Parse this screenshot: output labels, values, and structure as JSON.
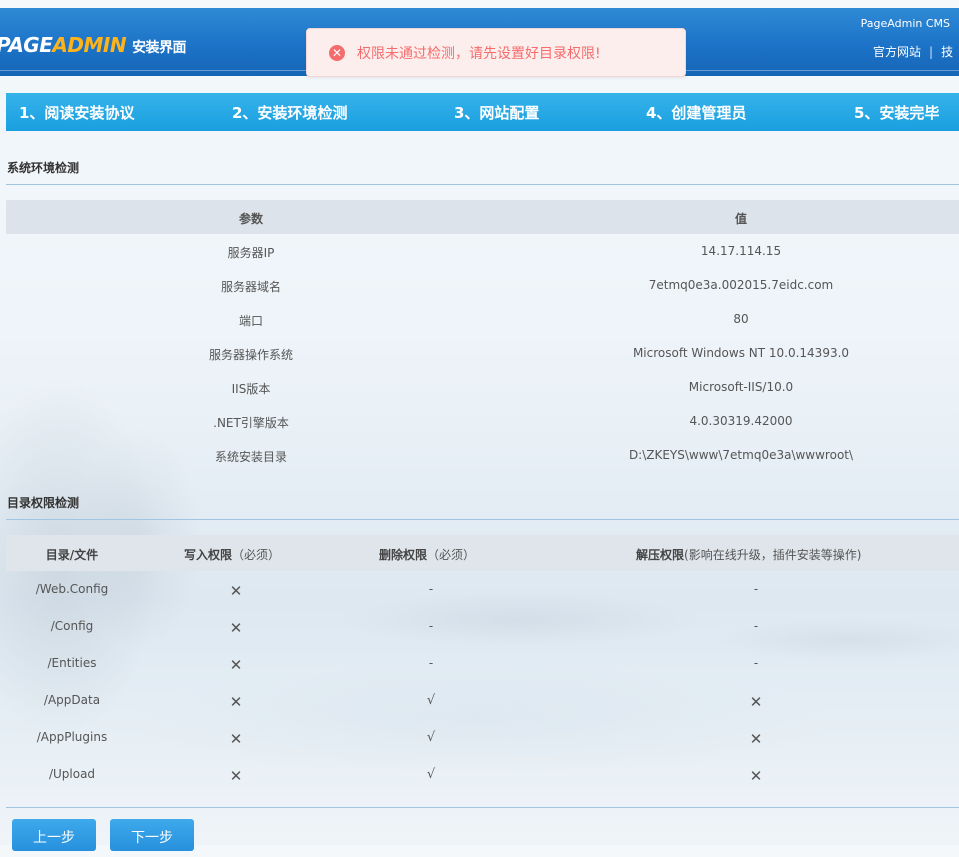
{
  "header": {
    "logo_part1": "PAGE",
    "logo_part2": "ADMIN",
    "logo_part3": "安装界面",
    "cms_label": "PageAdmin CMS",
    "links": [
      "官方网站",
      "技"
    ]
  },
  "toast": {
    "icon": "error-circle-icon",
    "message": "权限未通过检测，请先设置好目录权限!",
    "color": "#f56c6c"
  },
  "steps": [
    "1、阅读安装协议",
    "2、安装环境检测",
    "3、网站配置",
    "4、创建管理员",
    "5、安装完毕"
  ],
  "env_section": {
    "title": "系统环境检测",
    "headers": [
      "参数",
      "值"
    ],
    "rows": [
      {
        "param": "服务器IP",
        "value": "14.17.114.15"
      },
      {
        "param": "服务器域名",
        "value": "7etmq0e3a.002015.7eidc.com"
      },
      {
        "param": "端口",
        "value": "80"
      },
      {
        "param": "服务器操作系统",
        "value": "Microsoft Windows NT 10.0.14393.0"
      },
      {
        "param": "IIS版本",
        "value": "Microsoft-IIS/10.0"
      },
      {
        "param": ".NET引擎版本",
        "value": "4.0.30319.42000"
      },
      {
        "param": "系统安装目录",
        "value": "D:\\ZKEYS\\www\\7etmq0e3a\\wwwroot\\"
      }
    ]
  },
  "perm_section": {
    "title": "目录权限检测",
    "headers": {
      "path": "目录/文件",
      "write": "写入权限",
      "write_note": "（必须）",
      "delete": "删除权限",
      "delete_note": "（必须）",
      "unzip": "解压权限",
      "unzip_note": "(影响在线升级，插件安装等操作)"
    },
    "rows": [
      {
        "path": "/Web.Config",
        "write": "✕",
        "delete": "-",
        "unzip": "-"
      },
      {
        "path": "/Config",
        "write": "✕",
        "delete": "-",
        "unzip": "-"
      },
      {
        "path": "/Entities",
        "write": "✕",
        "delete": "-",
        "unzip": "-"
      },
      {
        "path": "/AppData",
        "write": "✕",
        "delete": "√",
        "unzip": "✕"
      },
      {
        "path": "/AppPlugins",
        "write": "✕",
        "delete": "√",
        "unzip": "✕"
      },
      {
        "path": "/Upload",
        "write": "✕",
        "delete": "√",
        "unzip": "✕"
      }
    ]
  },
  "buttons": {
    "prev": "上一步",
    "next": "下一步"
  },
  "colors": {
    "header_blue": "#1c73c7",
    "steps_blue": "#1a9fe0",
    "logo_orange": "#ffb31a",
    "fail_red": "#e02020"
  }
}
